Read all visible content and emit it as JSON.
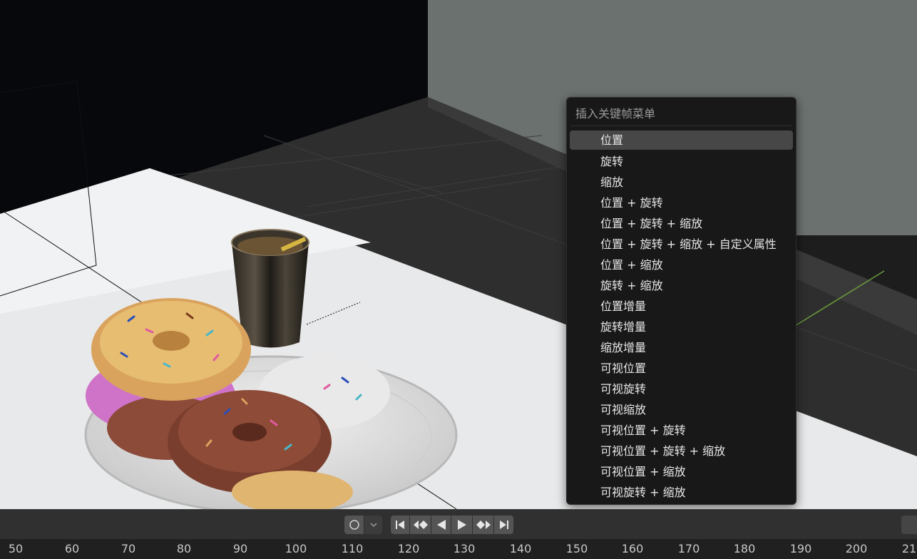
{
  "menu": {
    "title": "插入关键帧菜单",
    "items": [
      {
        "label": "位置"
      },
      {
        "label": "旋转"
      },
      {
        "label": "缩放"
      },
      {
        "label": "位置 + 旋转"
      },
      {
        "label": "位置 + 旋转 + 缩放"
      },
      {
        "label": "位置 + 旋转 + 缩放 + 自定义属性"
      },
      {
        "label": "位置 + 缩放"
      },
      {
        "label": "旋转 + 缩放"
      },
      {
        "label": "位置增量"
      },
      {
        "label": "旋转增量"
      },
      {
        "label": "缩放增量"
      },
      {
        "label": "可视位置"
      },
      {
        "label": "可视旋转"
      },
      {
        "label": "可视缩放"
      },
      {
        "label": "可视位置 + 旋转"
      },
      {
        "label": "可视位置 + 旋转 + 缩放"
      },
      {
        "label": "可视位置 + 缩放"
      },
      {
        "label": "可视旋转 + 缩放"
      }
    ],
    "active_index": 0
  },
  "timeline": {
    "ruler_ticks": [
      "50",
      "60",
      "70",
      "80",
      "90",
      "100",
      "110",
      "120",
      "130",
      "140",
      "150",
      "160",
      "170",
      "180",
      "190",
      "200",
      "21"
    ],
    "playback_icons": [
      "record-keying-icon",
      "keying-dropdown-icon",
      "jump-start-icon",
      "prev-keyframe-icon",
      "play-reverse-icon",
      "play-icon",
      "next-keyframe-icon",
      "jump-end-icon"
    ]
  },
  "colors": {
    "menu_bg": "#181818",
    "menu_active": "#474747",
    "timeline_bg": "#303030",
    "button_bg": "#545454"
  }
}
